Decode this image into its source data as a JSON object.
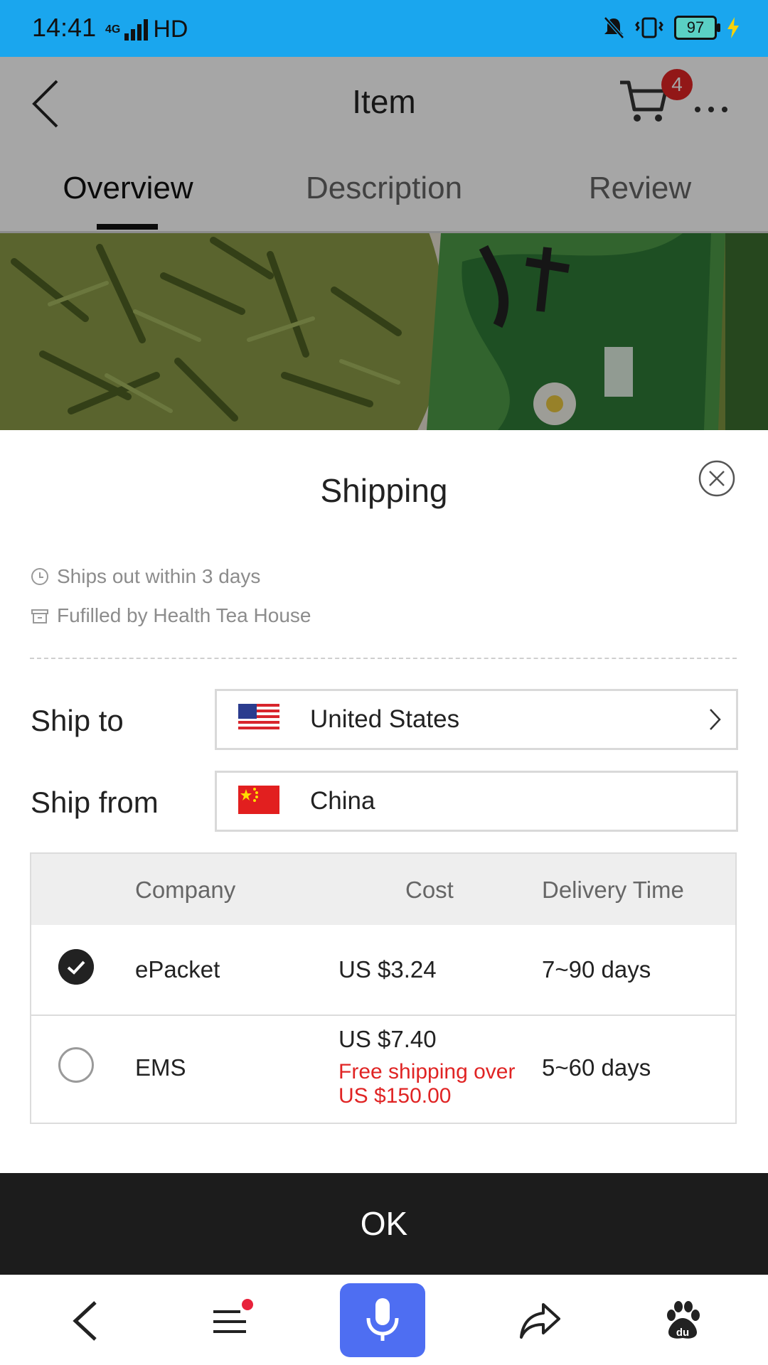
{
  "status_bar": {
    "time": "14:41",
    "network": "4G",
    "hd": "HD",
    "battery": "97"
  },
  "header": {
    "title": "Item",
    "cart_count": "4"
  },
  "tabs": [
    {
      "label": "Overview",
      "active": true
    },
    {
      "label": "Description",
      "active": false
    },
    {
      "label": "Review",
      "active": false
    }
  ],
  "sheet": {
    "title": "Shipping",
    "ships_out": "Ships out within 3 days",
    "fulfilled_by": "Fufilled by Health Tea House",
    "ship_to_label": "Ship to",
    "ship_to_value": "United States",
    "ship_from_label": "Ship from",
    "ship_from_value": "China",
    "table": {
      "headers": [
        "Company",
        "Cost",
        "Delivery Time"
      ],
      "rows": [
        {
          "company": "ePacket",
          "cost": "US $3.24",
          "note": "",
          "time": "7~90 days",
          "selected": true
        },
        {
          "company": "EMS",
          "cost": "US $7.40",
          "note": "Free shipping over US $150.00",
          "time": "5~60 days",
          "selected": false
        }
      ]
    },
    "ok_label": "OK"
  },
  "icons": [
    "back-icon",
    "cart-icon",
    "more-icon",
    "close-icon",
    "clock-icon",
    "store-icon",
    "chevron-right-icon",
    "check-icon",
    "menu-icon",
    "microphone-icon",
    "share-icon",
    "baidu-paw-icon"
  ],
  "colors": {
    "status_bar": "#1aa6ee",
    "accent_red": "#e02424",
    "mic_button": "#4e6ef2",
    "ok_button": "#1c1c1c"
  }
}
